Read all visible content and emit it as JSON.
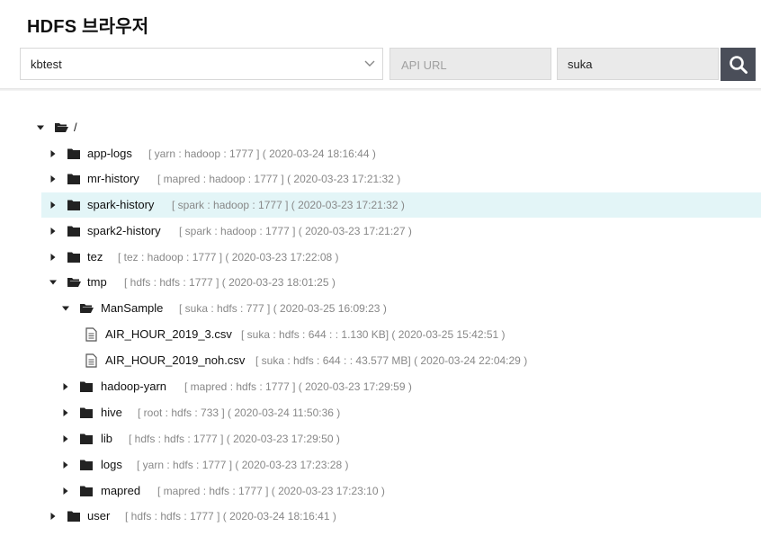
{
  "header": {
    "title": "HDFS 브라우저"
  },
  "toolbar": {
    "cluster_value": "kbtest",
    "api_url_placeholder": "API URL",
    "user_value": "suka"
  },
  "colors": {
    "selected_row": "#e3f5f7",
    "search_button": "#4a4e59",
    "folder": "#222222"
  },
  "tree": {
    "root": {
      "name": "/",
      "icon": "folder-open-icon",
      "expanded": true
    },
    "nodes": [
      {
        "name": "app-logs",
        "meta": "[ yarn : hadoop : 1777 ] ( 2020-03-24 18:16:44 )",
        "type": "folder",
        "expanded": false
      },
      {
        "name": "mr-history",
        "meta": "[ mapred : hadoop : 1777 ] ( 2020-03-23 17:21:32 )",
        "type": "folder",
        "expanded": false
      },
      {
        "name": "spark-history",
        "meta": "[ spark : hadoop : 1777 ] ( 2020-03-23 17:21:32 )",
        "type": "folder",
        "expanded": false,
        "selected": true
      },
      {
        "name": "spark2-history",
        "meta": "[ spark : hadoop : 1777 ] ( 2020-03-23 17:21:27 )",
        "type": "folder",
        "expanded": false
      },
      {
        "name": "tez",
        "meta": "[ tez : hadoop : 1777 ] ( 2020-03-23 17:22:08 )",
        "type": "folder",
        "expanded": false
      },
      {
        "name": "tmp",
        "meta": "[ hdfs : hdfs : 1777 ] ( 2020-03-23 18:01:25 )",
        "type": "folder",
        "expanded": true
      },
      {
        "name": "ManSample",
        "meta": "[ suka : hdfs : 777 ] ( 2020-03-25 16:09:23 )",
        "type": "folder",
        "expanded": true
      },
      {
        "name": "AIR_HOUR_2019_3.csv",
        "meta": "[ suka : hdfs : 644 : : 1.130 KB] ( 2020-03-25 15:42:51 )",
        "type": "file"
      },
      {
        "name": "AIR_HOUR_2019_noh.csv",
        "meta": "[ suka : hdfs : 644 : : 43.577 MB] ( 2020-03-24 22:04:29 )",
        "type": "file"
      },
      {
        "name": "hadoop-yarn",
        "meta": "[ mapred : hdfs : 1777 ] ( 2020-03-23 17:29:59 )",
        "type": "folder",
        "expanded": false
      },
      {
        "name": "hive",
        "meta": "[ root : hdfs : 733 ] ( 2020-03-24 11:50:36 )",
        "type": "folder",
        "expanded": false
      },
      {
        "name": "lib",
        "meta": "[ hdfs : hdfs : 1777 ] ( 2020-03-23 17:29:50 )",
        "type": "folder",
        "expanded": false
      },
      {
        "name": "logs",
        "meta": "[ yarn : hdfs : 1777 ] ( 2020-03-23 17:23:28 )",
        "type": "folder",
        "expanded": false
      },
      {
        "name": "mapred",
        "meta": "[ mapred : hdfs : 1777 ] ( 2020-03-23 17:23:10 )",
        "type": "folder",
        "expanded": false
      },
      {
        "name": "user",
        "meta": "[ hdfs : hdfs : 1777 ] ( 2020-03-24 18:16:41 )",
        "type": "folder",
        "expanded": false
      }
    ]
  }
}
